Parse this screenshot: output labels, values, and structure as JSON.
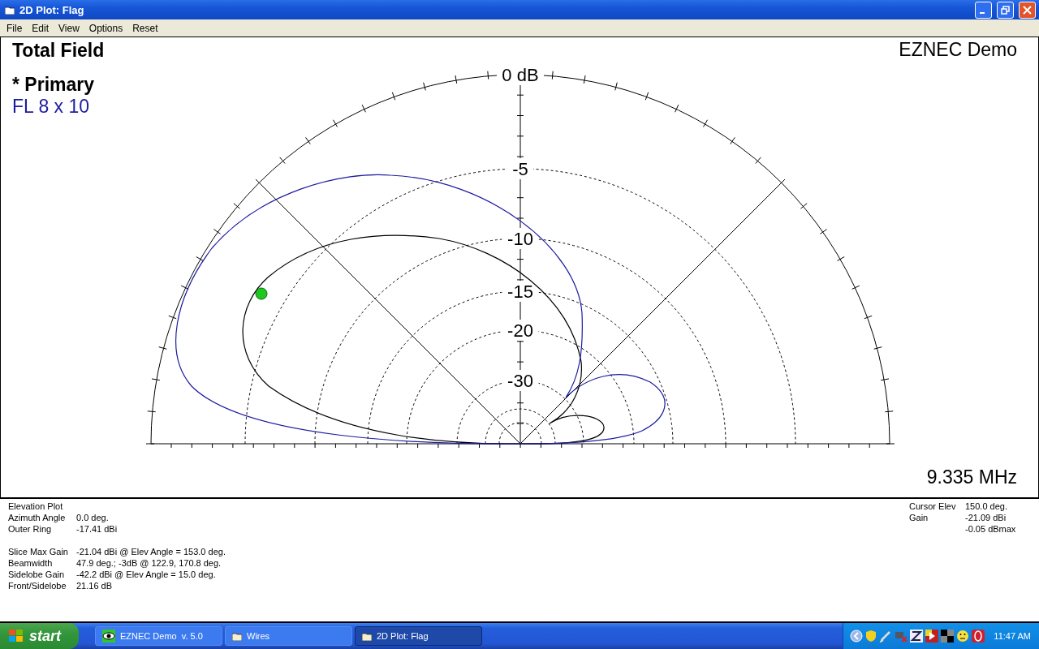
{
  "window": {
    "title": "2D Plot: Flag"
  },
  "menu": [
    "File",
    "Edit",
    "View",
    "Options",
    "Reset"
  ],
  "plot": {
    "title": "Total Field",
    "program": "EZNEC Demo",
    "trace_heading": "* Primary",
    "traces": [
      {
        "name": "FL 8 x 10",
        "color": "#1c1ca0"
      }
    ],
    "ring_labels": [
      "0 dB",
      "-5",
      "-10",
      "-15",
      "-20",
      "-30"
    ],
    "frequency": "9.335 MHz"
  },
  "info": {
    "groups": [
      [
        {
          "label": "Elevation Plot"
        },
        {
          "label": "Azimuth Angle",
          "value": "0.0 deg."
        },
        {
          "label": "Outer Ring",
          "value": "-17.41 dBi"
        }
      ],
      [
        {
          "label": "Slice Max Gain",
          "value": "-21.04 dBi @ Elev Angle = 153.0 deg."
        },
        {
          "label": "Beamwidth",
          "value": "47.9 deg.; -3dB @ 122.9, 170.8 deg."
        },
        {
          "label": "Sidelobe Gain",
          "value": "-42.2 dBi @ Elev Angle = 15.0 deg."
        },
        {
          "label": "Front/Sidelobe",
          "value": "21.16 dB"
        }
      ]
    ],
    "cursor": [
      {
        "label": "Cursor Elev",
        "value": "150.0 deg."
      },
      {
        "label": "Gain",
        "value": "-21.09 dBi"
      },
      {
        "value": "-0.05 dBmax"
      }
    ]
  },
  "taskbar": {
    "start": "start",
    "tasks": [
      {
        "label": "EZNEC Demo  v. 5.0",
        "selected": false
      },
      {
        "label": "Wires",
        "selected": false
      },
      {
        "label": "2D Plot: Flag",
        "selected": true
      }
    ],
    "clock": "11:47 AM"
  }
}
